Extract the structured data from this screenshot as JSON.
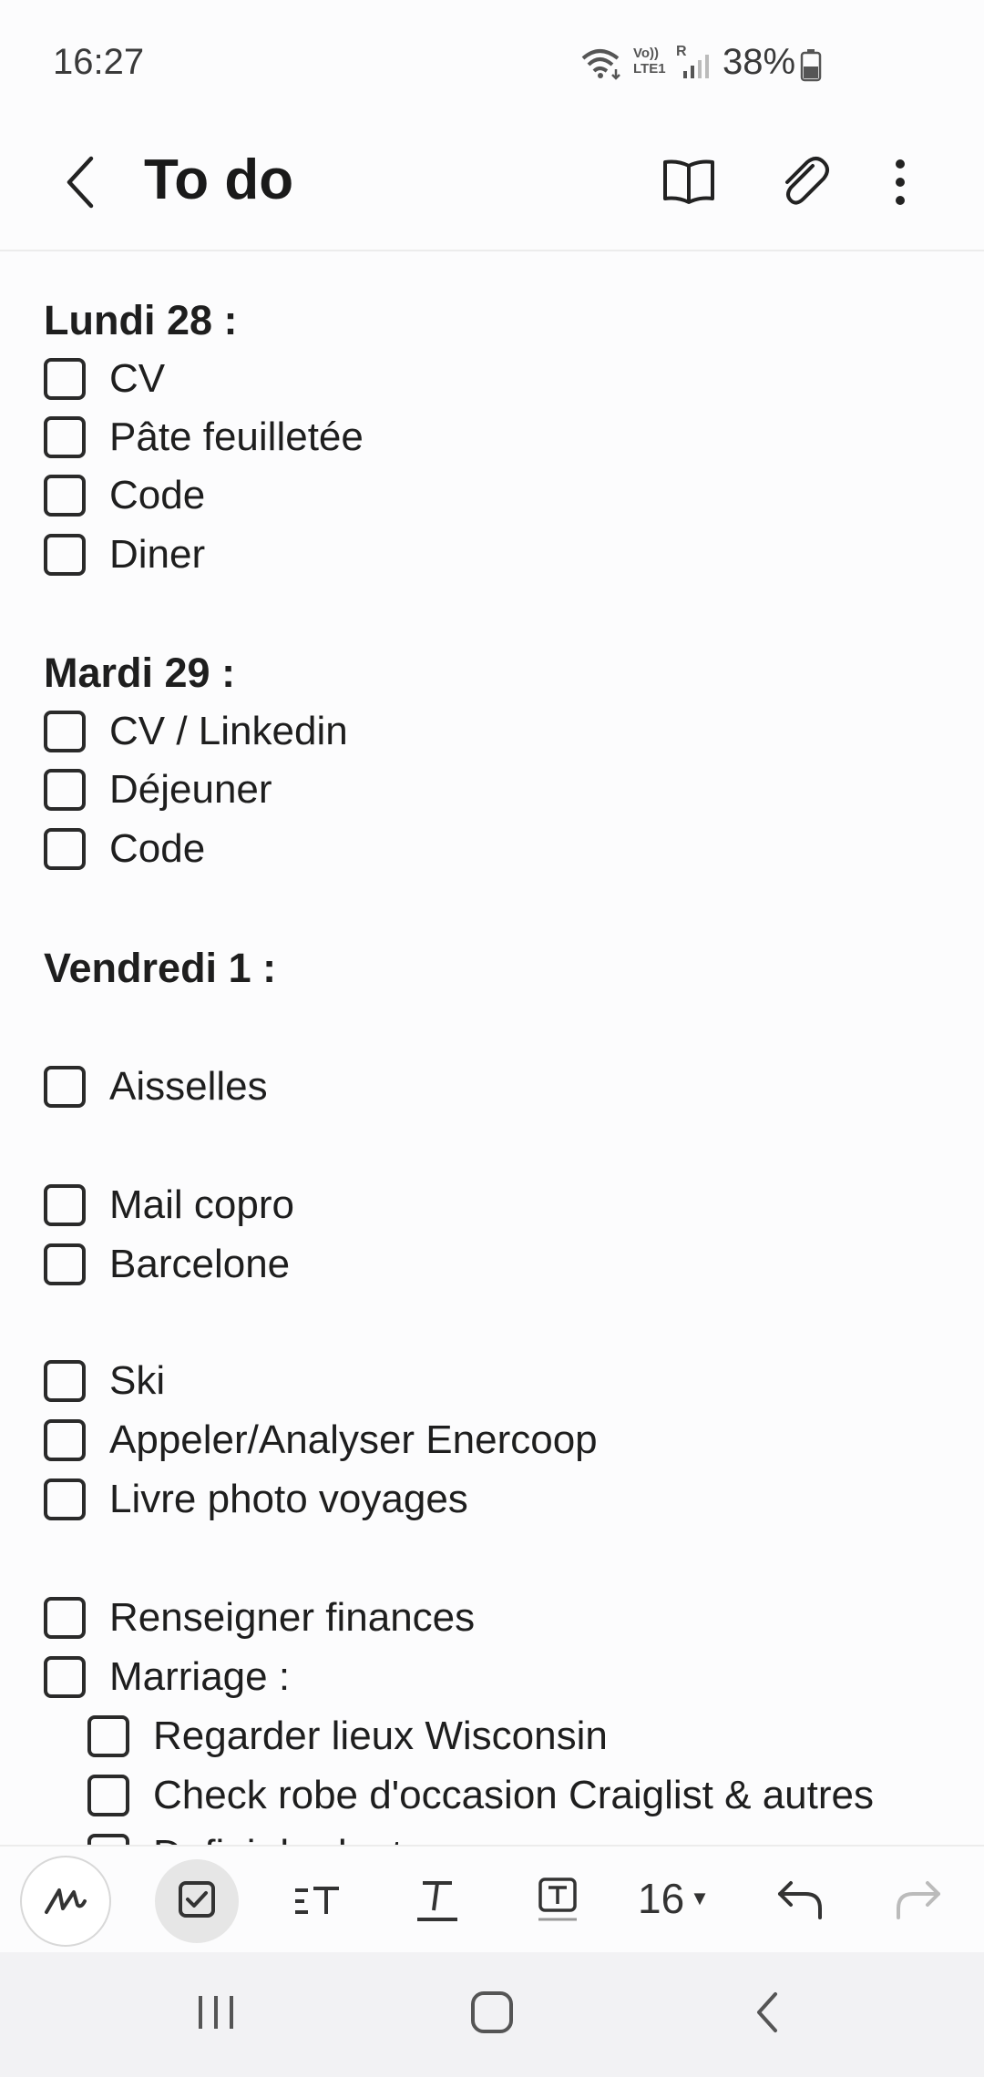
{
  "status_bar": {
    "time": "16:27",
    "network_label": "Vo)) LTE1",
    "roaming": "R",
    "battery": "38%",
    "icons": [
      "wifi-icon",
      "signal-icon",
      "battery-icon"
    ]
  },
  "header": {
    "title": "To do",
    "icons": [
      "back-icon",
      "reading-mode-icon",
      "attach-icon",
      "more-options-icon"
    ]
  },
  "note": {
    "lines": [
      {
        "type": "heading",
        "text": "Lundi 28 :"
      },
      {
        "type": "check",
        "text": "CV"
      },
      {
        "type": "check",
        "text": "Pâte feuilletée"
      },
      {
        "type": "check",
        "text": "Code"
      },
      {
        "type": "check",
        "text": "Diner"
      },
      {
        "type": "heading",
        "text": "Mardi 29 :"
      },
      {
        "type": "check",
        "text": "CV / Linkedin"
      },
      {
        "type": "check",
        "text": "Déjeuner"
      },
      {
        "type": "check",
        "text": "Code"
      },
      {
        "type": "heading",
        "text": "Vendredi 1 :"
      },
      {
        "type": "check",
        "text": "Aisselles"
      },
      {
        "type": "check",
        "text": "Mail copro"
      },
      {
        "type": "check",
        "text": "Barcelone"
      },
      {
        "type": "check",
        "text": "Ski"
      },
      {
        "type": "check",
        "text": "Appeler/Analyser Enercoop"
      },
      {
        "type": "check",
        "text": "Livre photo voyages"
      },
      {
        "type": "check",
        "text": "Renseigner finances"
      },
      {
        "type": "check",
        "text": "Marriage :"
      },
      {
        "type": "check",
        "text": "Regarder lieux Wisconsin",
        "indent": 1
      },
      {
        "type": "check",
        "text": "Check robe d'occasion Craiglist & autres",
        "indent": 1
      },
      {
        "type": "check",
        "text": "Definir budget",
        "indent": 1
      }
    ]
  },
  "toolbar": {
    "font_size": "16",
    "icons": [
      "handwriting-icon",
      "checkbox-icon",
      "paragraph-style-icon",
      "text-style-icon",
      "text-box-icon",
      "undo-icon",
      "redo-icon"
    ]
  },
  "nav_bar": {
    "icons": [
      "recent-apps-icon",
      "home-icon",
      "back-nav-icon"
    ]
  }
}
